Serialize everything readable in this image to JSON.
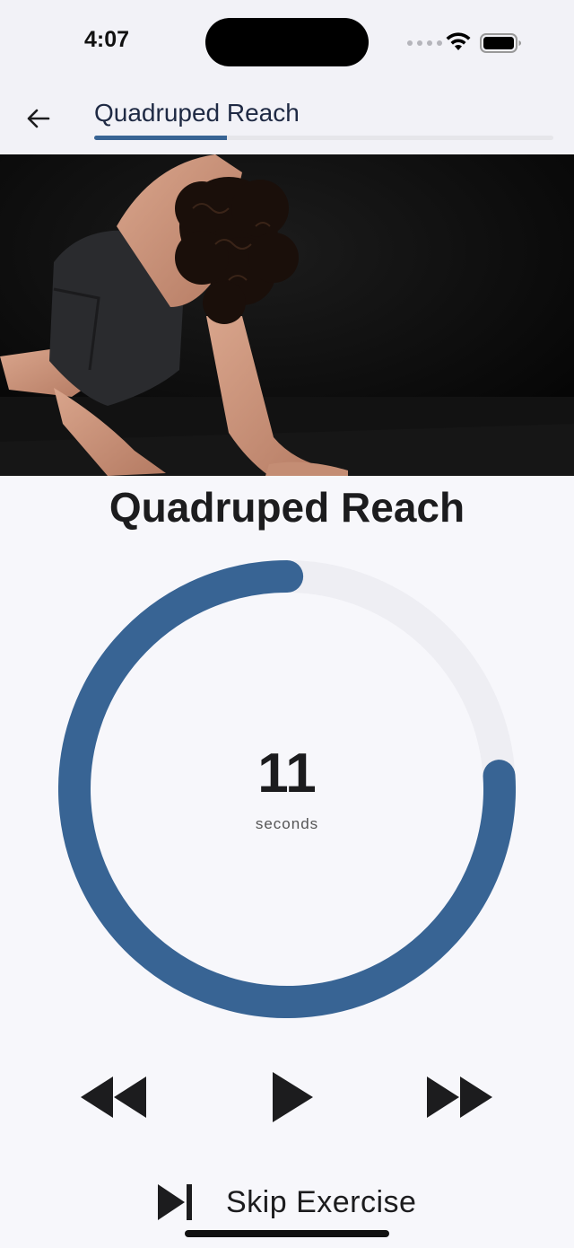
{
  "status_bar": {
    "time": "4:07"
  },
  "nav": {
    "title": "Quadruped Reach",
    "progress": 0.29
  },
  "exercise": {
    "title": "Quadruped Reach"
  },
  "timer": {
    "value": "11",
    "unit": "seconds",
    "progress": 0.76
  },
  "controls": {
    "rewind_icon": "rewind-icon",
    "play_icon": "play-icon",
    "forward_icon": "fast-forward-icon"
  },
  "skip": {
    "label": "Skip Exercise",
    "icon": "skip-next-icon"
  },
  "colors": {
    "accent": "#386494",
    "track": "#eeeef3",
    "background": "#f7f7fb"
  }
}
